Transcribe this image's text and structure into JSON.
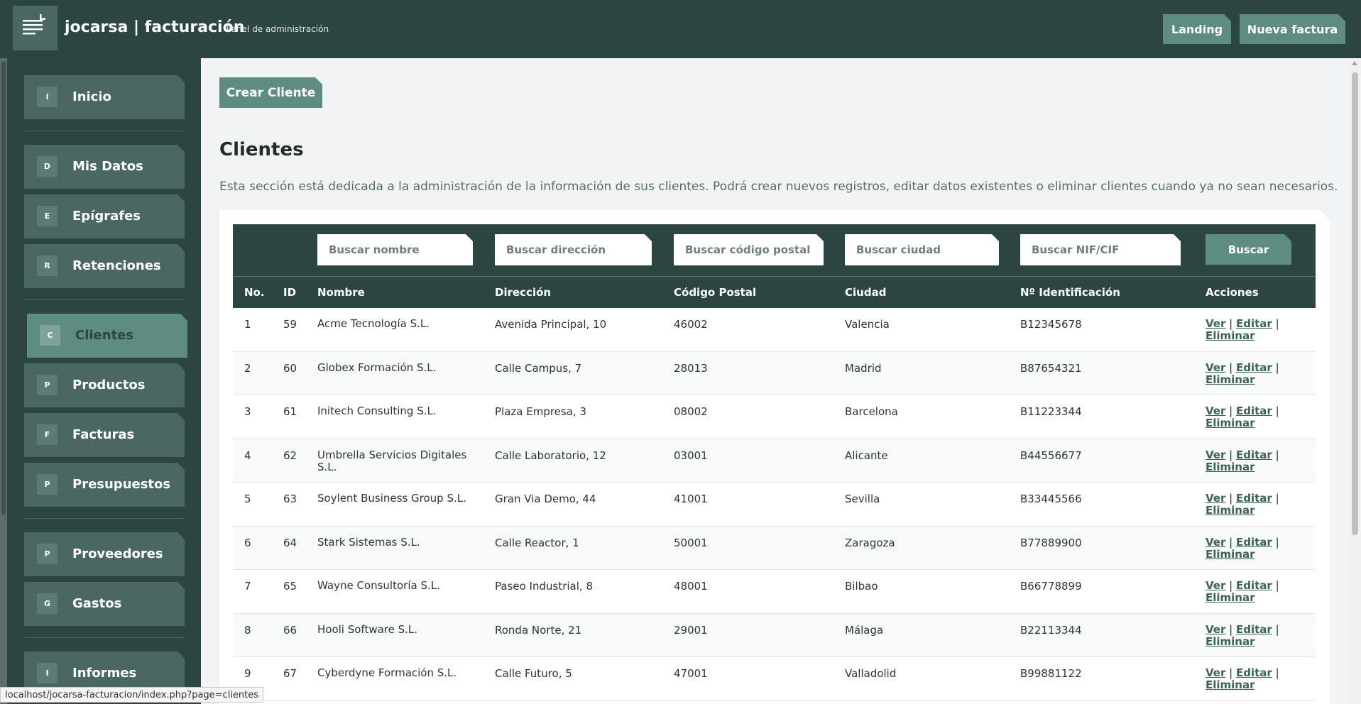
{
  "header": {
    "brand": "jocarsa | facturación",
    "subtitle": "Panel de administración",
    "buttons": [
      {
        "label": "Landing"
      },
      {
        "label": "Nueva factura"
      }
    ]
  },
  "sidebar": {
    "items": [
      {
        "letter": "I",
        "label": "Inicio"
      },
      {
        "letter": "D",
        "label": "Mis Datos"
      },
      {
        "letter": "E",
        "label": "Epígrafes"
      },
      {
        "letter": "R",
        "label": "Retenciones"
      },
      {
        "letter": "C",
        "label": "Clientes",
        "active": true
      },
      {
        "letter": "P",
        "label": "Productos"
      },
      {
        "letter": "F",
        "label": "Facturas"
      },
      {
        "letter": "P",
        "label": "Presupuestos"
      },
      {
        "letter": "P",
        "label": "Proveedores"
      },
      {
        "letter": "G",
        "label": "Gastos"
      },
      {
        "letter": "I",
        "label": "Informes"
      }
    ]
  },
  "main": {
    "create_label": "Crear Cliente",
    "title": "Clientes",
    "description": "Esta sección está dedicada a la administración de la información de sus clientes. Podrá crear nuevos registros, editar datos existentes o eliminar clientes cuando ya no sean necesarios."
  },
  "search": {
    "nombre": "Buscar nombre",
    "direccion": "Buscar dirección",
    "cp": "Buscar código postal",
    "ciudad": "Buscar ciudad",
    "nif": "Buscar NIF/CIF",
    "button": "Buscar"
  },
  "table": {
    "columns": [
      "No.",
      "ID",
      "Nombre",
      "Dirección",
      "Código Postal",
      "Ciudad",
      "Nº Identificación",
      "Acciones"
    ],
    "actions": {
      "ver": "Ver",
      "editar": "Editar",
      "eliminar": "Eliminar",
      "sep": "|"
    },
    "rows": [
      {
        "no": "1",
        "id": "59",
        "nombre": "Acme Tecnología S.L.",
        "direccion": "Avenida Principal, 10",
        "cp": "46002",
        "ciudad": "Valencia",
        "nif": "B12345678"
      },
      {
        "no": "2",
        "id": "60",
        "nombre": "Globex Formación S.L.",
        "direccion": "Calle Campus, 7",
        "cp": "28013",
        "ciudad": "Madrid",
        "nif": "B87654321"
      },
      {
        "no": "3",
        "id": "61",
        "nombre": "Initech Consulting S.L.",
        "direccion": "Plaza Empresa, 3",
        "cp": "08002",
        "ciudad": "Barcelona",
        "nif": "B11223344"
      },
      {
        "no": "4",
        "id": "62",
        "nombre": "Umbrella Servicios Digitales S.L.",
        "direccion": "Calle Laboratorio, 12",
        "cp": "03001",
        "ciudad": "Alicante",
        "nif": "B44556677"
      },
      {
        "no": "5",
        "id": "63",
        "nombre": "Soylent Business Group S.L.",
        "direccion": "Gran Via Demo, 44",
        "cp": "41001",
        "ciudad": "Sevilla",
        "nif": "B33445566"
      },
      {
        "no": "6",
        "id": "64",
        "nombre": "Stark Sistemas S.L.",
        "direccion": "Calle Reactor, 1",
        "cp": "50001",
        "ciudad": "Zaragoza",
        "nif": "B77889900"
      },
      {
        "no": "7",
        "id": "65",
        "nombre": "Wayne Consultoría S.L.",
        "direccion": "Paseo Industrial, 8",
        "cp": "48001",
        "ciudad": "Bilbao",
        "nif": "B66778899"
      },
      {
        "no": "8",
        "id": "66",
        "nombre": "Hooli Software S.L.",
        "direccion": "Ronda Norte, 21",
        "cp": "29001",
        "ciudad": "Málaga",
        "nif": "B22113344"
      },
      {
        "no": "9",
        "id": "67",
        "nombre": "Cyberdyne Formación S.L.",
        "direccion": "Calle Futuro, 5",
        "cp": "47001",
        "ciudad": "Valladolid",
        "nif": "B99881122"
      }
    ]
  },
  "status_url": "localhost/jocarsa-facturacion/index.php?page=clientes"
}
